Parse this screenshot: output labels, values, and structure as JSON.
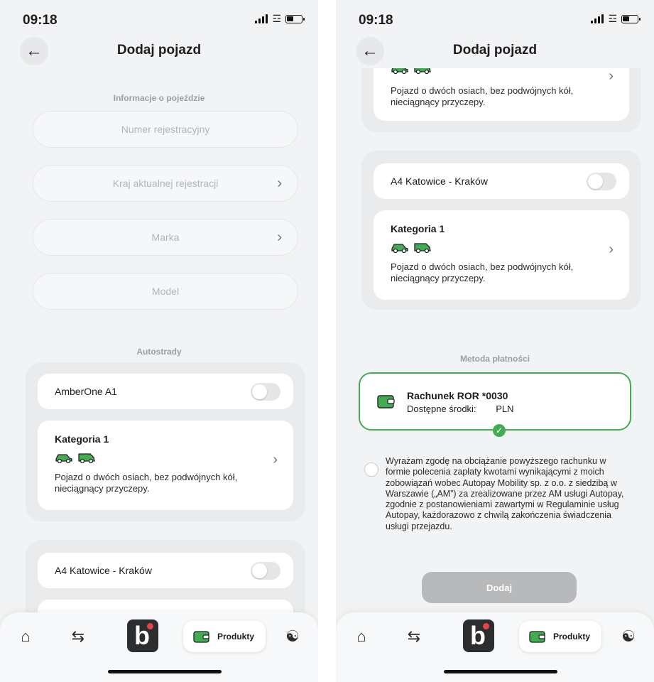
{
  "status": {
    "time": "09:18"
  },
  "header": {
    "title": "Dodaj pojazd"
  },
  "form": {
    "section_title": "Informacje o pojeździe",
    "registration_placeholder": "Numer rejestracyjny",
    "country_placeholder": "Kraj aktualnej rejestracji",
    "brand_placeholder": "Marka",
    "model_placeholder": "Model"
  },
  "highways": {
    "section_title": "Autostrady",
    "items": [
      {
        "name": "AmberOne A1",
        "enabled": false
      },
      {
        "name": "A4 Katowice - Kraków",
        "enabled": false
      }
    ],
    "category": {
      "title": "Kategoria 1",
      "description": "Pojazd o dwóch osiach, bez podwójnych kół, nieciągnący przyczepy."
    }
  },
  "payment": {
    "section_title": "Metoda płatności",
    "account_title": "Rachunek ROR *0030",
    "funds_label": "Dostępne środki:",
    "currency": "PLN",
    "selected": true
  },
  "consent": {
    "text": "Wyrażam zgodę na obciążanie powyższego rachunku w formie polecenia zapłaty kwotami wynikającymi z moich zobowiązań wobec Autopay Mobility sp. z o.o. z siedzibą w Warszawie („AM”) za zrealizowane przez AM usługi Autopay, zgodnie z postanowieniami zawartymi w Regulaminie usług Autopay, każdorazowo z chwilą zakończenia świadczenia usługi przejazdu.",
    "checked": false
  },
  "actions": {
    "add_label": "Dodaj"
  },
  "bottom_nav": {
    "products_label": "Produkty"
  },
  "colors": {
    "accent": "#43ac53",
    "background": "#f2f3f4",
    "logo_dot": "#e8414e"
  }
}
